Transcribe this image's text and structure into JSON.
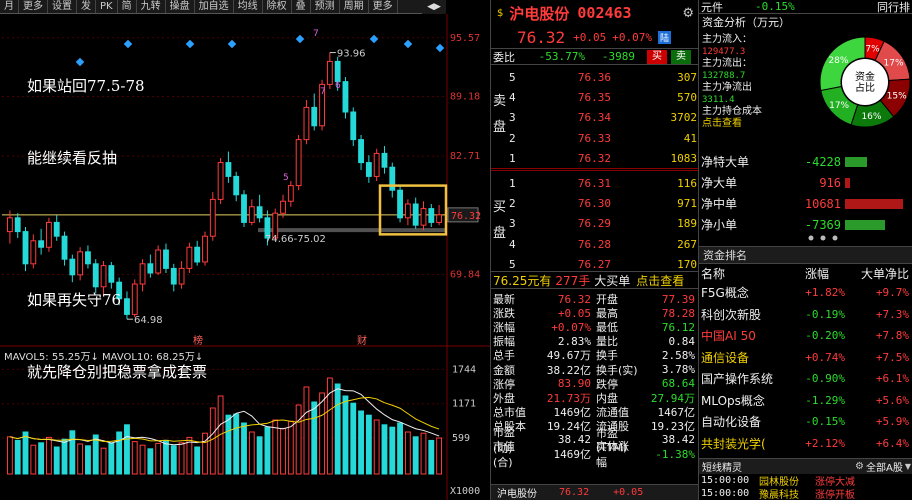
{
  "toolbar": {
    "items": [
      "月",
      "更多",
      "设置",
      "发",
      "PK",
      "简",
      "九转",
      "操盘",
      "加自选",
      "均线",
      "除权",
      "叠",
      "预测",
      "周期",
      "更多"
    ],
    "back_arrow": "◀",
    "forward_arrow": "▶"
  },
  "annotation": {
    "line1": "如果站回77.5-78",
    "line2": "能继续看反抽",
    "line3": "如果再失守76",
    "line4": "就先降仓别把稳票拿成套票"
  },
  "chart_data": {
    "type": "candlestick",
    "y_axis_ticks": [
      "95.57",
      "89.18",
      "82.71",
      "76.32",
      "69.84"
    ],
    "ylim": [
      62.5,
      97.5
    ],
    "current_price_label": "76.32",
    "annotations_text": {
      "high": "93.96",
      "low": "64.98",
      "support": "74.66-75.02"
    },
    "markers": [
      "7",
      "5",
      "6",
      "7",
      "榜",
      "财"
    ],
    "candles": [
      {
        "o": 74.5,
        "c": 76.0,
        "h": 76.8,
        "l": 73.2
      },
      {
        "o": 76.0,
        "c": 74.5,
        "h": 76.5,
        "l": 73.8
      },
      {
        "o": 74.5,
        "c": 71.0,
        "h": 75.0,
        "l": 70.2
      },
      {
        "o": 71.0,
        "c": 73.5,
        "h": 74.2,
        "l": 70.5
      },
      {
        "o": 73.5,
        "c": 72.8,
        "h": 74.8,
        "l": 72.0
      },
      {
        "o": 72.8,
        "c": 75.5,
        "h": 76.0,
        "l": 72.3
      },
      {
        "o": 75.5,
        "c": 74.0,
        "h": 76.3,
        "l": 73.5
      },
      {
        "o": 74.0,
        "c": 71.5,
        "h": 74.5,
        "l": 70.8
      },
      {
        "o": 71.5,
        "c": 69.8,
        "h": 72.0,
        "l": 69.0
      },
      {
        "o": 69.8,
        "c": 72.3,
        "h": 72.8,
        "l": 69.2
      },
      {
        "o": 72.3,
        "c": 71.0,
        "h": 73.0,
        "l": 70.5
      },
      {
        "o": 71.0,
        "c": 68.5,
        "h": 71.5,
        "l": 67.8
      },
      {
        "o": 68.5,
        "c": 70.8,
        "h": 71.3,
        "l": 67.5
      },
      {
        "o": 70.8,
        "c": 69.0,
        "h": 71.2,
        "l": 68.3
      },
      {
        "o": 69.0,
        "c": 67.2,
        "h": 69.5,
        "l": 66.5
      },
      {
        "o": 67.2,
        "c": 65.5,
        "h": 68.0,
        "l": 64.98
      },
      {
        "o": 65.5,
        "c": 68.8,
        "h": 69.3,
        "l": 65.2
      },
      {
        "o": 68.8,
        "c": 71.0,
        "h": 71.5,
        "l": 68.0
      },
      {
        "o": 71.0,
        "c": 70.0,
        "h": 72.0,
        "l": 69.5
      },
      {
        "o": 70.0,
        "c": 72.5,
        "h": 73.0,
        "l": 69.8
      },
      {
        "o": 72.5,
        "c": 70.5,
        "h": 73.2,
        "l": 70.0
      },
      {
        "o": 70.5,
        "c": 68.8,
        "h": 71.0,
        "l": 68.0
      },
      {
        "o": 68.8,
        "c": 70.5,
        "h": 71.3,
        "l": 68.3
      },
      {
        "o": 70.5,
        "c": 72.8,
        "h": 73.3,
        "l": 70.0
      },
      {
        "o": 72.8,
        "c": 71.2,
        "h": 73.5,
        "l": 70.8
      },
      {
        "o": 71.2,
        "c": 74.0,
        "h": 74.5,
        "l": 70.8
      },
      {
        "o": 74.0,
        "c": 78.0,
        "h": 78.8,
        "l": 73.5
      },
      {
        "o": 78.0,
        "c": 82.0,
        "h": 82.5,
        "l": 77.5
      },
      {
        "o": 82.0,
        "c": 80.5,
        "h": 83.2,
        "l": 79.8
      },
      {
        "o": 80.5,
        "c": 78.5,
        "h": 81.0,
        "l": 77.8
      },
      {
        "o": 78.5,
        "c": 75.5,
        "h": 79.0,
        "l": 75.0
      },
      {
        "o": 75.5,
        "c": 77.2,
        "h": 78.0,
        "l": 75.2
      },
      {
        "o": 77.2,
        "c": 76.0,
        "h": 78.5,
        "l": 75.5
      },
      {
        "o": 76.0,
        "c": 73.8,
        "h": 76.8,
        "l": 73.0
      },
      {
        "o": 73.8,
        "c": 76.5,
        "h": 77.0,
        "l": 73.5
      },
      {
        "o": 76.5,
        "c": 77.8,
        "h": 78.5,
        "l": 76.0
      },
      {
        "o": 77.8,
        "c": 79.5,
        "h": 80.0,
        "l": 77.2
      },
      {
        "o": 79.5,
        "c": 84.5,
        "h": 85.0,
        "l": 79.0
      },
      {
        "o": 84.5,
        "c": 88.0,
        "h": 88.8,
        "l": 84.0
      },
      {
        "o": 88.0,
        "c": 86.0,
        "h": 89.5,
        "l": 85.5
      },
      {
        "o": 86.0,
        "c": 90.5,
        "h": 91.0,
        "l": 85.5
      },
      {
        "o": 90.5,
        "c": 93.0,
        "h": 93.96,
        "l": 90.0
      },
      {
        "o": 93.0,
        "c": 90.8,
        "h": 93.5,
        "l": 89.8
      },
      {
        "o": 90.8,
        "c": 87.5,
        "h": 91.3,
        "l": 86.8
      },
      {
        "o": 87.5,
        "c": 84.5,
        "h": 88.0,
        "l": 83.8
      },
      {
        "o": 84.5,
        "c": 82.0,
        "h": 85.0,
        "l": 81.2
      },
      {
        "o": 82.0,
        "c": 80.5,
        "h": 82.8,
        "l": 79.8
      },
      {
        "o": 80.5,
        "c": 83.0,
        "h": 83.5,
        "l": 80.0
      },
      {
        "o": 83.0,
        "c": 81.5,
        "h": 83.8,
        "l": 80.8
      },
      {
        "o": 81.5,
        "c": 79.0,
        "h": 82.0,
        "l": 78.2
      },
      {
        "o": 79.0,
        "c": 76.0,
        "h": 79.5,
        "l": 75.5
      },
      {
        "o": 76.0,
        "c": 77.5,
        "h": 78.0,
        "l": 75.2
      },
      {
        "o": 77.5,
        "c": 75.2,
        "h": 78.2,
        "l": 74.8
      },
      {
        "o": 75.2,
        "c": 77.0,
        "h": 77.8,
        "l": 74.66
      },
      {
        "o": 77.0,
        "c": 75.5,
        "h": 77.5,
        "l": 75.0
      },
      {
        "o": 75.5,
        "c": 76.32,
        "h": 77.39,
        "l": 75.2
      }
    ],
    "volume_label": "MAVOL5: 55.25万↓  MAVOL10: 68.25万↓",
    "volume_ticks": [
      "1744",
      "1171",
      "599",
      "X1000"
    ],
    "volumes": [
      620,
      560,
      700,
      480,
      520,
      610,
      450,
      580,
      720,
      500,
      470,
      650,
      430,
      520,
      700,
      820,
      540,
      480,
      420,
      510,
      560,
      470,
      520,
      610,
      450,
      680,
      1100,
      1300,
      980,
      1000,
      850,
      700,
      620,
      780,
      900,
      760,
      880,
      1150,
      1450,
      1200,
      1350,
      1600,
      1500,
      1300,
      1180,
      1050,
      980,
      900,
      820,
      780,
      850,
      700,
      620,
      680,
      560,
      600
    ]
  },
  "quote": {
    "name": "沪电股份",
    "code": "002463",
    "price": "76.32",
    "change": "+0.05",
    "pct": "+0.07%",
    "tag": "陆",
    "weibi_label": "委比",
    "weibi": "-53.77%",
    "weicha": "-3989",
    "buy_btn": "买",
    "sell_btn": "卖"
  },
  "sell_side_label": [
    "卖",
    "盘"
  ],
  "buy_side_label": [
    "买",
    "盘"
  ],
  "asks": [
    {
      "lvl": "5",
      "price": "76.36",
      "vol": "307"
    },
    {
      "lvl": "4",
      "price": "76.35",
      "vol": "570"
    },
    {
      "lvl": "3",
      "price": "76.34",
      "vol": "3702"
    },
    {
      "lvl": "2",
      "price": "76.33",
      "vol": "41"
    },
    {
      "lvl": "1",
      "price": "76.32",
      "vol": "1083"
    }
  ],
  "bids": [
    {
      "lvl": "1",
      "price": "76.31",
      "vol": "116"
    },
    {
      "lvl": "2",
      "price": "76.30",
      "vol": "971"
    },
    {
      "lvl": "3",
      "price": "76.29",
      "vol": "189"
    },
    {
      "lvl": "4",
      "price": "76.28",
      "vol": "267"
    },
    {
      "lvl": "5",
      "price": "76.27",
      "vol": "170"
    }
  ],
  "bigorder": {
    "price": "76.25元有",
    "hands": "277手",
    "label": "大买单",
    "link": "点击查看"
  },
  "stats_left": [
    {
      "k": "最新",
      "v": "76.32",
      "c": "red"
    },
    {
      "k": "涨跌",
      "v": "+0.05",
      "c": "red"
    },
    {
      "k": "涨幅",
      "v": "+0.07%",
      "c": "red"
    },
    {
      "k": "振幅",
      "v": "2.83%",
      "c": "white"
    },
    {
      "k": "总手",
      "v": "49.67万",
      "c": "white"
    },
    {
      "k": "金额",
      "v": "38.22亿",
      "c": "white"
    },
    {
      "k": "涨停",
      "v": "83.90",
      "c": "red"
    },
    {
      "k": "外盘",
      "v": "21.73万",
      "c": "red"
    },
    {
      "k": "总市值",
      "v": "1469亿",
      "c": "white"
    },
    {
      "k": "总股本",
      "v": "19.24亿",
      "c": "white"
    },
    {
      "k": "市盈(动)",
      "v": "38.42",
      "c": "white"
    },
    {
      "k": "市值(合)",
      "v": "1469亿",
      "c": "white"
    }
  ],
  "stats_right": [
    {
      "k": "开盘",
      "v": "77.39",
      "c": "red"
    },
    {
      "k": "最高",
      "v": "78.28",
      "c": "red"
    },
    {
      "k": "最低",
      "v": "76.12",
      "c": "green"
    },
    {
      "k": "量比",
      "v": "0.84",
      "c": "white"
    },
    {
      "k": "换手",
      "v": "2.58%",
      "c": "white"
    },
    {
      "k": "换手(实)",
      "v": "3.78%",
      "c": "white"
    },
    {
      "k": "跌停",
      "v": "68.64",
      "c": "green"
    },
    {
      "k": "内盘",
      "v": "27.94万",
      "c": "green"
    },
    {
      "k": "流通值",
      "v": "1467亿",
      "c": "white"
    },
    {
      "k": "流通股",
      "v": "19.23亿",
      "c": "white"
    },
    {
      "k": "市盈(TTM)",
      "v": "38.42",
      "c": "white"
    },
    {
      "k": "实体涨幅",
      "v": "-1.38%",
      "c": "green"
    }
  ],
  "footer_quote": {
    "name": "沪电股份",
    "price": "76.32",
    "change": "+0.05"
  },
  "far_right": {
    "top_label": "元件",
    "top_pct": "-0.15%",
    "top_right": "同行排",
    "capital_title": "资金分析（万元）",
    "flow_in_label": "主力流入：",
    "flow_in": "129477.3",
    "flow_out_label": "主力流出：",
    "flow_out": "132788.7",
    "net_label": "主力净流出",
    "net": "3311.4",
    "cost_label": "主力持仓成本",
    "cost_link": "点击查看",
    "donut_center": "资金\n占比",
    "donut_slices": [
      {
        "label": "7%",
        "color": "#e00000",
        "value": 7
      },
      {
        "label": "17%",
        "color": "#e04a4a",
        "value": 17
      },
      {
        "label": "15%",
        "color": "#8b0000",
        "value": 15
      },
      {
        "label": "16%",
        "color": "#0b7a0b",
        "value": 16
      },
      {
        "label": "17%",
        "color": "#22b022",
        "value": 17
      },
      {
        "label": "28%",
        "color": "#3ed63e",
        "value": 28
      }
    ],
    "net_flows": [
      {
        "k": "净特大单",
        "v": "-4228",
        "c": "green",
        "bar": 0.35
      },
      {
        "k": "净大单",
        "v": "916",
        "c": "red",
        "bar": 0.08
      },
      {
        "k": "净中单",
        "v": "10681",
        "c": "red",
        "bar": 0.9
      },
      {
        "k": "净小单",
        "v": "-7369",
        "c": "green",
        "bar": 0.62
      }
    ],
    "sector_title": "资金排名",
    "sector_cols": [
      "名称",
      "涨幅",
      "大单净比"
    ],
    "sectors": [
      {
        "name": "F5G概念",
        "pct": "+1.82%",
        "pc": "red",
        "net": "+9.7%",
        "nc": "red",
        "nmc": "white"
      },
      {
        "name": "科创次新股",
        "pct": "-0.19%",
        "pc": "green",
        "net": "+7.3%",
        "nc": "red",
        "nmc": "white"
      },
      {
        "name": "中国AI 50",
        "pct": "-0.20%",
        "pc": "green",
        "net": "+7.8%",
        "nc": "red",
        "nmc": "red"
      },
      {
        "name": "通信设备",
        "pct": "+0.74%",
        "pc": "red",
        "net": "+7.5%",
        "nc": "red",
        "nmc": "yel"
      },
      {
        "name": "国产操作系统",
        "pct": "-0.90%",
        "pc": "green",
        "net": "+6.1%",
        "nc": "red",
        "nmc": "white"
      },
      {
        "name": "MLOps概念",
        "pct": "-1.29%",
        "pc": "green",
        "net": "+5.6%",
        "nc": "red",
        "nmc": "white"
      },
      {
        "name": "自动化设备",
        "pct": "-0.15%",
        "pc": "green",
        "net": "+5.9%",
        "nc": "red",
        "nmc": "white"
      },
      {
        "name": "共封装光学(",
        "pct": "+2.12%",
        "pc": "red",
        "net": "+6.4%",
        "nc": "red",
        "nmc": "yel"
      }
    ],
    "elf_title": "短线精灵",
    "elf_filter": "全部A股",
    "elf_rows": [
      {
        "t": "15:00:00",
        "n": "园林股份",
        "e": "涨停大减"
      },
      {
        "t": "15:00:00",
        "n": "豫晨科技",
        "e": "涨停开板"
      }
    ]
  }
}
